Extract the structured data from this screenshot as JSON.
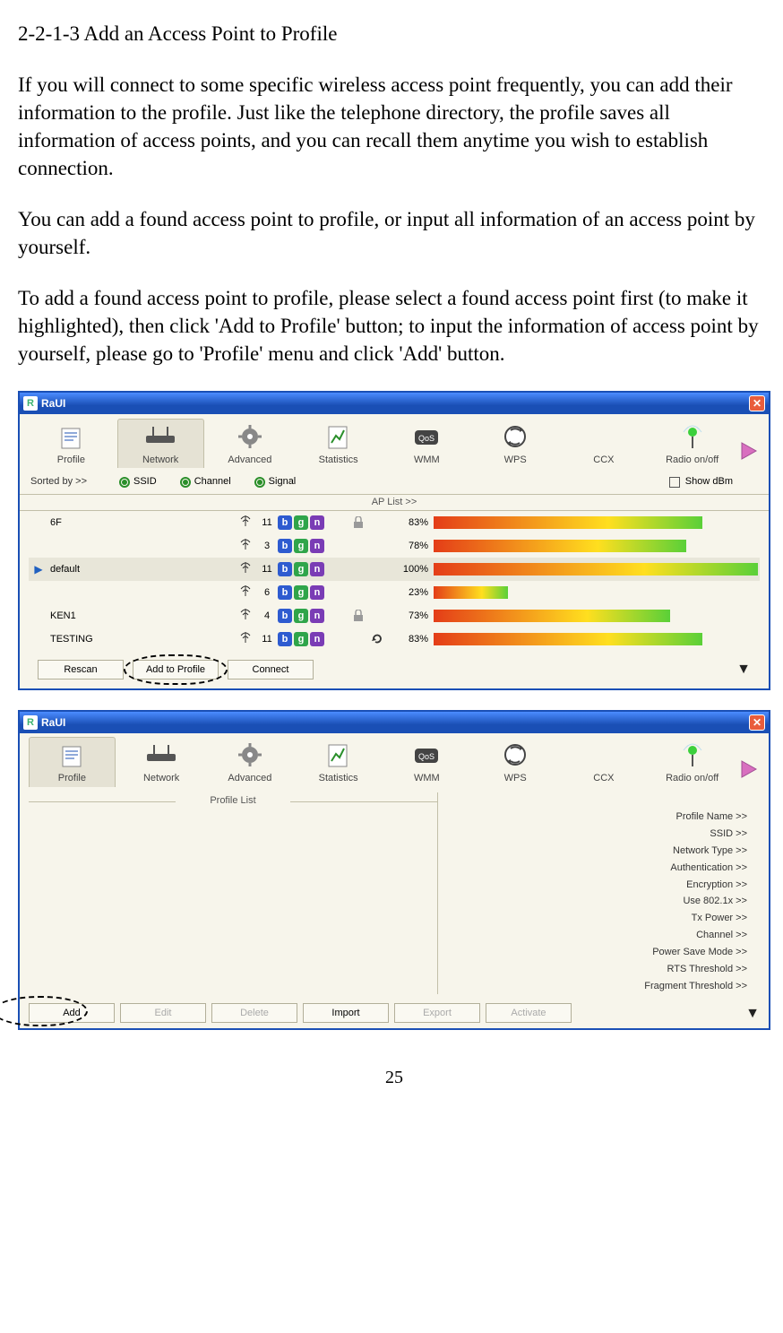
{
  "doc": {
    "heading": "2-2-1-3 Add an Access Point to Profile",
    "p1": "If you will connect to some specific wireless access point frequently, you can add their information to the profile. Just like the telephone directory, the profile saves all information of access points, and you can recall them anytime you wish to establish connection.",
    "p2": "You can add a found access point to profile, or input all information of an access point by yourself.",
    "p3": "To add a found access point to profile, please select a found access point first (to make it highlighted), then click 'Add to Profile' button; to input the information of access point by yourself, please go to 'Profile' menu and click 'Add' button.",
    "pagenum": "25"
  },
  "app": {
    "title": "RaUI",
    "logo_letter": "R",
    "tabs": [
      "Profile",
      "Network",
      "Advanced",
      "Statistics",
      "WMM",
      "WPS",
      "CCX",
      "Radio on/off"
    ]
  },
  "window1": {
    "active_tab_index": 1,
    "sort": {
      "label": "Sorted by >>",
      "options": [
        "SSID",
        "Channel",
        "Signal"
      ],
      "show_dbm_label": "Show dBm",
      "show_dbm_checked": false,
      "ap_list_header": "AP List >>"
    },
    "ap_rows": [
      {
        "indicator": false,
        "ssid": "6F",
        "channel": "11",
        "badges": [
          "b",
          "g",
          "n"
        ],
        "lock": true,
        "refresh": false,
        "pct": "83%",
        "bar_pct": 83
      },
      {
        "indicator": false,
        "ssid": "",
        "channel": "3",
        "badges": [
          "b",
          "g",
          "n"
        ],
        "lock": false,
        "refresh": false,
        "pct": "78%",
        "bar_pct": 78
      },
      {
        "indicator": true,
        "ssid": "default",
        "channel": "11",
        "badges": [
          "b",
          "g",
          "n"
        ],
        "lock": false,
        "refresh": false,
        "pct": "100%",
        "bar_pct": 100
      },
      {
        "indicator": false,
        "ssid": "",
        "channel": "6",
        "badges": [
          "b",
          "g",
          "n"
        ],
        "lock": false,
        "refresh": false,
        "pct": "23%",
        "bar_pct": 23
      },
      {
        "indicator": false,
        "ssid": "KEN1",
        "channel": "4",
        "badges": [
          "b",
          "g",
          "n"
        ],
        "lock": true,
        "refresh": false,
        "pct": "73%",
        "bar_pct": 73
      },
      {
        "indicator": false,
        "ssid": "TESTING",
        "channel": "11",
        "badges": [
          "b",
          "g",
          "n"
        ],
        "lock": false,
        "refresh": true,
        "pct": "83%",
        "bar_pct": 83
      }
    ],
    "buttons": {
      "rescan": "Rescan",
      "add_to_profile": "Add to Profile",
      "connect": "Connect"
    }
  },
  "window2": {
    "active_tab_index": 0,
    "profile_list_label": "Profile List",
    "attrs": [
      "Profile Name >>",
      "SSID >>",
      "Network Type >>",
      "Authentication >>",
      "Encryption >>",
      "Use 802.1x >>",
      "Tx Power >>",
      "Channel >>",
      "Power Save Mode >>",
      "RTS Threshold >>",
      "Fragment Threshold >>"
    ],
    "buttons": {
      "add": "Add",
      "edit": "Edit",
      "delete": "Delete",
      "import": "Import",
      "export": "Export",
      "activate": "Activate"
    }
  }
}
